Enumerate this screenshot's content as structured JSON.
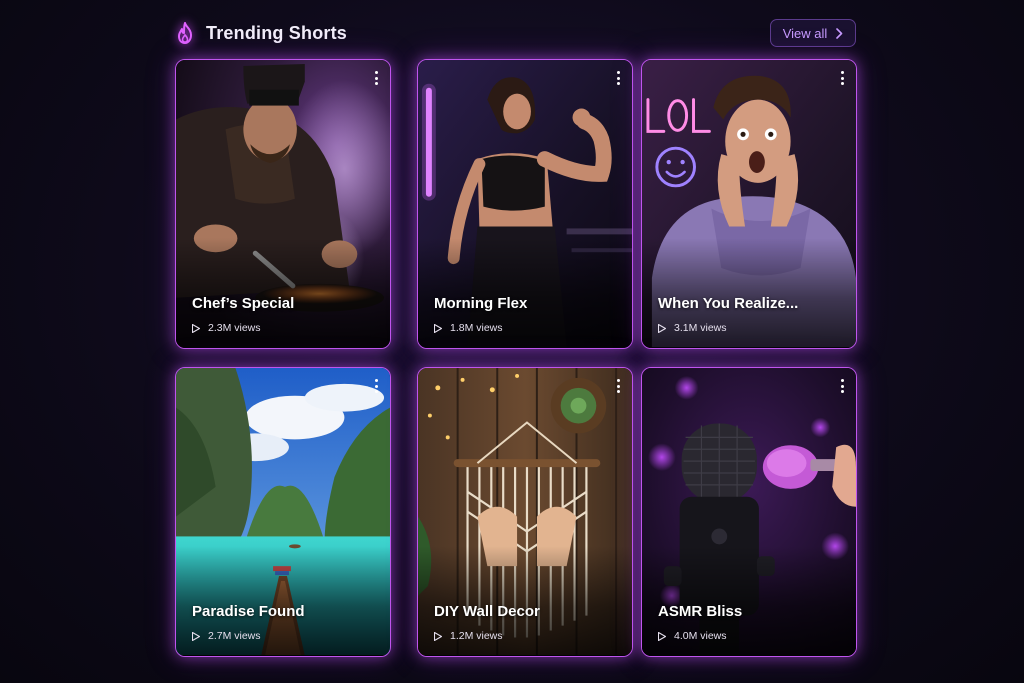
{
  "section": {
    "title": "Trending Shorts",
    "icon": "flame-icon",
    "view_all_label": "View all",
    "accent": "#c055ee"
  },
  "shorts": [
    {
      "title": "Chef’s Special",
      "views": "2.3M views"
    },
    {
      "title": "Morning Flex",
      "views": "1.8M views"
    },
    {
      "title": "When You Realize...",
      "views": "3.1M views"
    },
    {
      "title": "Paradise Found",
      "views": "2.7M views"
    },
    {
      "title": "DIY Wall Decor",
      "views": "1.2M views"
    },
    {
      "title": "ASMR Bliss",
      "views": "4.0M views"
    }
  ]
}
